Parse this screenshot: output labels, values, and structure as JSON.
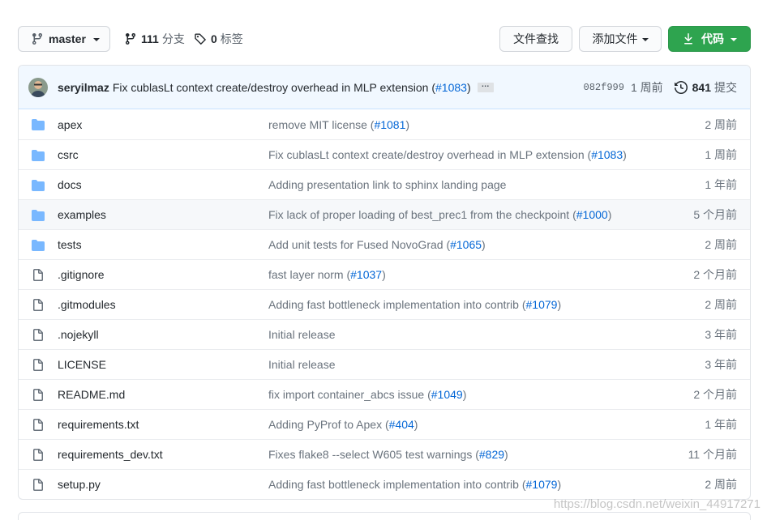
{
  "toolbar": {
    "branch_label": "master",
    "branches_count": "111",
    "branches_label": "分支",
    "tags_count": "0",
    "tags_label": "标签",
    "find_file_label": "文件查找",
    "add_file_label": "添加文件",
    "code_label": "代码",
    "code_color": "#2ea44f"
  },
  "commit": {
    "author": "seryilmaz",
    "message_prefix": "Fix cublasLt context create/destroy overhead in MLP extension (",
    "pr_link": "#1083",
    "message_suffix": ")",
    "ellipsis": "…",
    "sha": "082f999",
    "time": "1 周前",
    "commit_count": "841",
    "commit_label": "提交"
  },
  "files": [
    {
      "type": "dir",
      "name": "apex",
      "msg": "remove MIT license (",
      "pr": "#1081",
      "msg_end": ")",
      "age": "2 周前"
    },
    {
      "type": "dir",
      "name": "csrc",
      "msg": "Fix cublasLt context create/destroy overhead in MLP extension (",
      "pr": "#1083",
      "msg_end": ")",
      "age": "1 周前"
    },
    {
      "type": "dir",
      "name": "docs",
      "msg": "Adding presentation link to sphinx landing page",
      "pr": "",
      "msg_end": "",
      "age": "1 年前"
    },
    {
      "type": "dir",
      "name": "examples",
      "msg": "Fix lack of proper loading of best_prec1 from the checkpoint (",
      "pr": "#1000",
      "msg_end": ")",
      "age": "5 个月前"
    },
    {
      "type": "dir",
      "name": "tests",
      "msg": "Add unit tests for Fused NovoGrad (",
      "pr": "#1065",
      "msg_end": ")",
      "age": "2 周前"
    },
    {
      "type": "file",
      "name": ".gitignore",
      "msg": "fast layer norm (",
      "pr": "#1037",
      "msg_end": ")",
      "age": "2 个月前"
    },
    {
      "type": "file",
      "name": ".gitmodules",
      "msg": "Adding fast bottleneck implementation into contrib (",
      "pr": "#1079",
      "msg_end": ")",
      "age": "2 周前"
    },
    {
      "type": "file",
      "name": ".nojekyll",
      "msg": "Initial release",
      "pr": "",
      "msg_end": "",
      "age": "3 年前"
    },
    {
      "type": "file",
      "name": "LICENSE",
      "msg": "Initial release",
      "pr": "",
      "msg_end": "",
      "age": "3 年前"
    },
    {
      "type": "file",
      "name": "README.md",
      "msg": "fix import container_abcs issue (",
      "pr": "#1049",
      "msg_end": ")",
      "age": "2 个月前"
    },
    {
      "type": "file",
      "name": "requirements.txt",
      "msg": "Adding PyProf to Apex (",
      "pr": "#404",
      "msg_end": ")",
      "age": "1 年前"
    },
    {
      "type": "file",
      "name": "requirements_dev.txt",
      "msg": "Fixes flake8 --select W605 test warnings (",
      "pr": "#829",
      "msg_end": ")",
      "age": "11 个月前"
    },
    {
      "type": "file",
      "name": "setup.py",
      "msg": "Adding fast bottleneck implementation into contrib (",
      "pr": "#1079",
      "msg_end": ")",
      "age": "2 周前"
    }
  ],
  "highlighted_row": 3,
  "watermark": "https://blog.csdn.net/weixin_44917271",
  "colors": {
    "folder": "#79b8ff",
    "link": "#0366d6",
    "commit_bg": "#f1f8ff"
  },
  "icons": {
    "branch": "git-branch-icon",
    "tag": "tag-icon",
    "download": "download-icon",
    "history": "history-icon",
    "folder": "folder-icon",
    "file": "file-icon"
  }
}
